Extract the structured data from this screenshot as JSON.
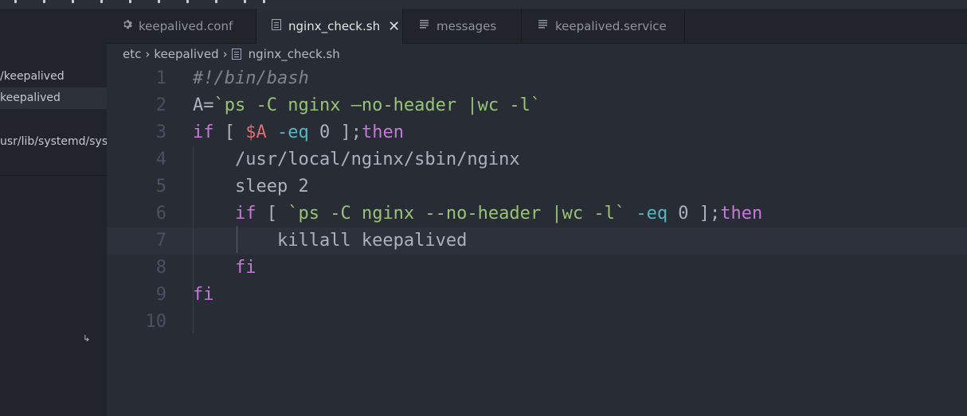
{
  "sidebar": {
    "items": [
      {
        "label": "/keepalived",
        "active": false
      },
      {
        "label": "keepalived",
        "active": true
      },
      {
        "label": "usr/lib/systemd/sys...",
        "active": false
      }
    ]
  },
  "tabs": [
    {
      "label": "keepalived.conf",
      "icon": "gear-icon",
      "active": false
    },
    {
      "label": "nginx_check.sh",
      "icon": "file-icon",
      "active": true,
      "close": "✕"
    },
    {
      "label": "messages",
      "icon": "lines-icon",
      "active": false
    },
    {
      "label": "keepalived.service",
      "icon": "lines-icon",
      "active": false
    }
  ],
  "breadcrumb": {
    "parts": [
      "etc",
      "keepalived",
      "nginx_check.sh"
    ]
  },
  "editor": {
    "current_line": 7,
    "lines": [
      {
        "n": "1",
        "tokens": [
          {
            "t": "#!/bin/bash",
            "c": "comment"
          }
        ]
      },
      {
        "n": "2",
        "tokens": [
          {
            "t": "A=",
            "c": "plain"
          },
          {
            "t": "`ps -C nginx –no-header |wc -l`",
            "c": "str"
          }
        ]
      },
      {
        "n": "3",
        "tokens": [
          {
            "t": "if",
            "c": "kw"
          },
          {
            "t": " [ ",
            "c": "plain"
          },
          {
            "t": "$A",
            "c": "var"
          },
          {
            "t": " -eq",
            "c": "op"
          },
          {
            "t": " 0 ];",
            "c": "plain"
          },
          {
            "t": "then",
            "c": "kw"
          }
        ]
      },
      {
        "n": "4",
        "tokens": [
          {
            "t": "    /usr/local/nginx/sbin/nginx",
            "c": "plain"
          }
        ]
      },
      {
        "n": "5",
        "tokens": [
          {
            "t": "    sleep 2",
            "c": "plain"
          }
        ]
      },
      {
        "n": "6",
        "tokens": [
          {
            "t": "    ",
            "c": "plain"
          },
          {
            "t": "if",
            "c": "kw"
          },
          {
            "t": " [ ",
            "c": "plain"
          },
          {
            "t": "`ps -C nginx --no-header |wc -l`",
            "c": "str"
          },
          {
            "t": " -eq",
            "c": "op"
          },
          {
            "t": " 0 ];",
            "c": "plain"
          },
          {
            "t": "then",
            "c": "kw"
          }
        ]
      },
      {
        "n": "7",
        "tokens": [
          {
            "t": "        killall keepalived",
            "c": "plain"
          }
        ]
      },
      {
        "n": "8",
        "tokens": [
          {
            "t": "    ",
            "c": "plain"
          },
          {
            "t": "fi",
            "c": "kw"
          }
        ]
      },
      {
        "n": "9",
        "tokens": [
          {
            "t": "fi",
            "c": "kw"
          }
        ]
      },
      {
        "n": "10",
        "tokens": []
      }
    ]
  },
  "colors": {
    "background": "#282c34",
    "sidebar": "#21252b",
    "keyword": "#c678dd",
    "string": "#98c379",
    "variable": "#e06c75",
    "operator": "#56b6c2",
    "comment": "#7f848e"
  }
}
